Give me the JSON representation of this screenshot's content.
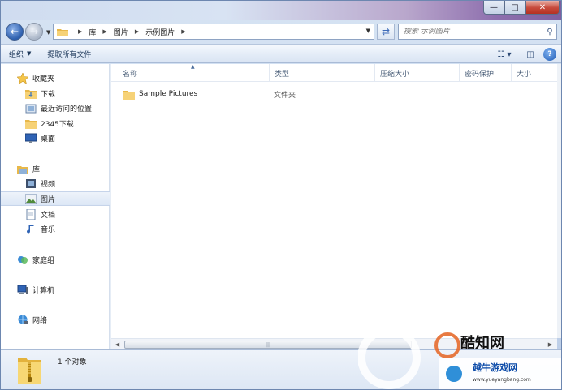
{
  "titlebar": {
    "caption": {
      "minimize": "—",
      "maximize": "□",
      "close": "✕"
    }
  },
  "navigation": {
    "back_icon": "back-arrow-icon",
    "forward_icon": "forward-arrow-icon",
    "breadcrumbs": [
      "库",
      "图片",
      "示例图片"
    ],
    "search_placeholder": "搜索 示例图片"
  },
  "commandbar": {
    "organize": "组织",
    "extract_all": "提取所有文件"
  },
  "sidebar": {
    "favorites": {
      "label": "收藏夹",
      "items": [
        {
          "label": "下载",
          "icon": "download-folder-icon"
        },
        {
          "label": "最近访问的位置",
          "icon": "recent-places-icon"
        },
        {
          "label": "2345下载",
          "icon": "folder-icon"
        },
        {
          "label": "桌面",
          "icon": "desktop-icon"
        }
      ]
    },
    "libraries": {
      "label": "库",
      "items": [
        {
          "label": "视频",
          "icon": "video-library-icon"
        },
        {
          "label": "图片",
          "icon": "pictures-library-icon",
          "selected": true
        },
        {
          "label": "文档",
          "icon": "documents-library-icon"
        },
        {
          "label": "音乐",
          "icon": "music-library-icon"
        }
      ]
    },
    "homegroup": "家庭组",
    "computer": "计算机",
    "network": "网络"
  },
  "columns": [
    "名称",
    "类型",
    "压缩大小",
    "密码保护",
    "大小"
  ],
  "files": [
    {
      "name": "Sample Pictures",
      "type": "文件夹"
    }
  ],
  "status": {
    "count_text": "1 个对象"
  },
  "watermark": {
    "brand1": "酷知网",
    "brand2": "越牛游戏网",
    "url": "www.yueyangbang.com"
  },
  "colors": {
    "accent": "#3d6ab8",
    "folder": "#f2c94c",
    "close": "#c7493a"
  }
}
